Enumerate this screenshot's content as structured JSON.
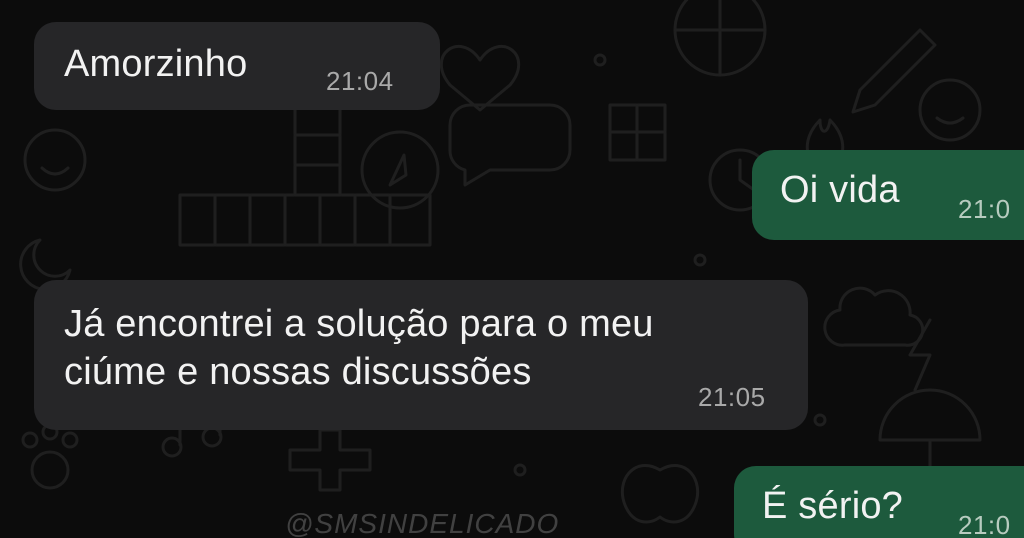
{
  "messages": [
    {
      "direction": "incoming",
      "text": "Amorzinho",
      "time": "21:04"
    },
    {
      "direction": "outgoing",
      "text": "Oi vida",
      "time": "21:0"
    },
    {
      "direction": "incoming",
      "text": "Já encontrei a solução para o meu\nciúme e nossas discussões",
      "time": "21:05"
    },
    {
      "direction": "outgoing",
      "text": "É sério?",
      "time": "21:0"
    }
  ],
  "watermark": "@SMSINDELICADO",
  "colors": {
    "background": "#0c0c0c",
    "incoming_bubble": "#262628",
    "outgoing_bubble": "#1d5a3d",
    "text": "#f2f2f2",
    "timestamp": "#a9a9a9"
  }
}
